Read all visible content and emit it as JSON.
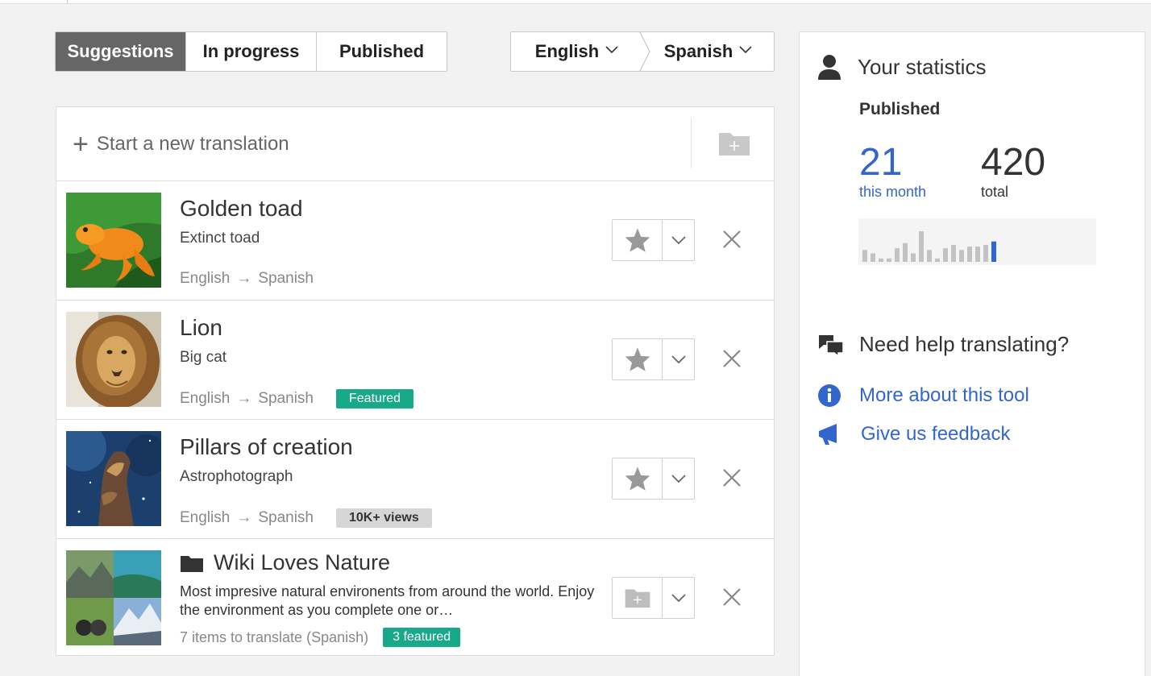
{
  "tabs": [
    {
      "label": "Suggestions",
      "active": true
    },
    {
      "label": "In progress",
      "active": false
    },
    {
      "label": "Published",
      "active": false
    }
  ],
  "languages": {
    "source": "English",
    "target": "Spanish"
  },
  "new_translation": {
    "label": "Start a new translation"
  },
  "items": [
    {
      "title": "Golden toad",
      "description": "Extinct toad",
      "source_lang": "English",
      "target_lang": "Spanish",
      "arrow": "→",
      "badge": ""
    },
    {
      "title": "Lion",
      "description": "Big cat",
      "source_lang": "English",
      "target_lang": "Spanish",
      "arrow": "→",
      "badge": "Featured"
    },
    {
      "title": "Pillars of creation",
      "description": "Astrophotograph",
      "source_lang": "English",
      "target_lang": "Spanish",
      "arrow": "→",
      "badge": "10K+ views"
    }
  ],
  "collection": {
    "title": "Wiki Loves Nature",
    "description": "Most impresive natural environents from around the world. Enjoy the environment as you complete one or…",
    "meta": "7 items to translate (Spanish)",
    "badge": "3 featured"
  },
  "stats": {
    "title": "Your statistics",
    "published_label": "Published",
    "month_value": "21",
    "month_label": "this month",
    "total_value": "420",
    "total_label": "total",
    "sparkline": [
      14,
      10,
      4,
      4,
      16,
      22,
      10,
      36,
      14,
      4,
      16,
      20,
      14,
      18,
      18,
      20,
      24
    ],
    "bar_color": "#c2c2c2",
    "highlight_color": "#3366cc"
  },
  "help": {
    "title": "Need help translating?",
    "links": [
      {
        "label": "More about this tool"
      },
      {
        "label": "Give us feedback"
      }
    ]
  },
  "colors": {
    "accent": "#3366cc",
    "green": "#17a988",
    "tab_active": "#666666"
  }
}
